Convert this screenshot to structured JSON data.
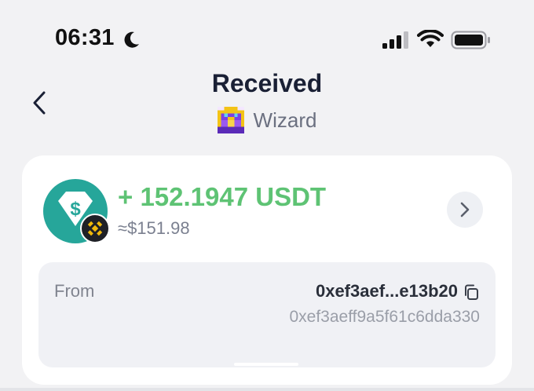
{
  "status_bar": {
    "time": "06:31",
    "icons": [
      "moon-icon",
      "signal-icon",
      "wifi-icon",
      "battery-icon"
    ]
  },
  "header": {
    "back_icon": "chevron-left-icon",
    "title": "Received",
    "wallet_name": "Wizard",
    "wallet_avatar": "pixel-wizard-avatar"
  },
  "transaction": {
    "token_icon": "usdt-icon",
    "chain_badge": "bnb-chain-icon",
    "amount": "+ 152.1947 USDT",
    "fiat_value": "≈$151.98",
    "detail_icon": "chevron-right-icon",
    "from_label": "From",
    "from_short": "0xef3aef...e13b20",
    "from_full": "0xef3aeff9a5f61c6dda330",
    "copy_icon": "copy-icon"
  },
  "colors": {
    "background": "#f2f2f4",
    "card": "#ffffff",
    "amount_green": "#5ec374",
    "usdt_teal": "#26a69a",
    "bnb_gold": "#f0b90b"
  }
}
